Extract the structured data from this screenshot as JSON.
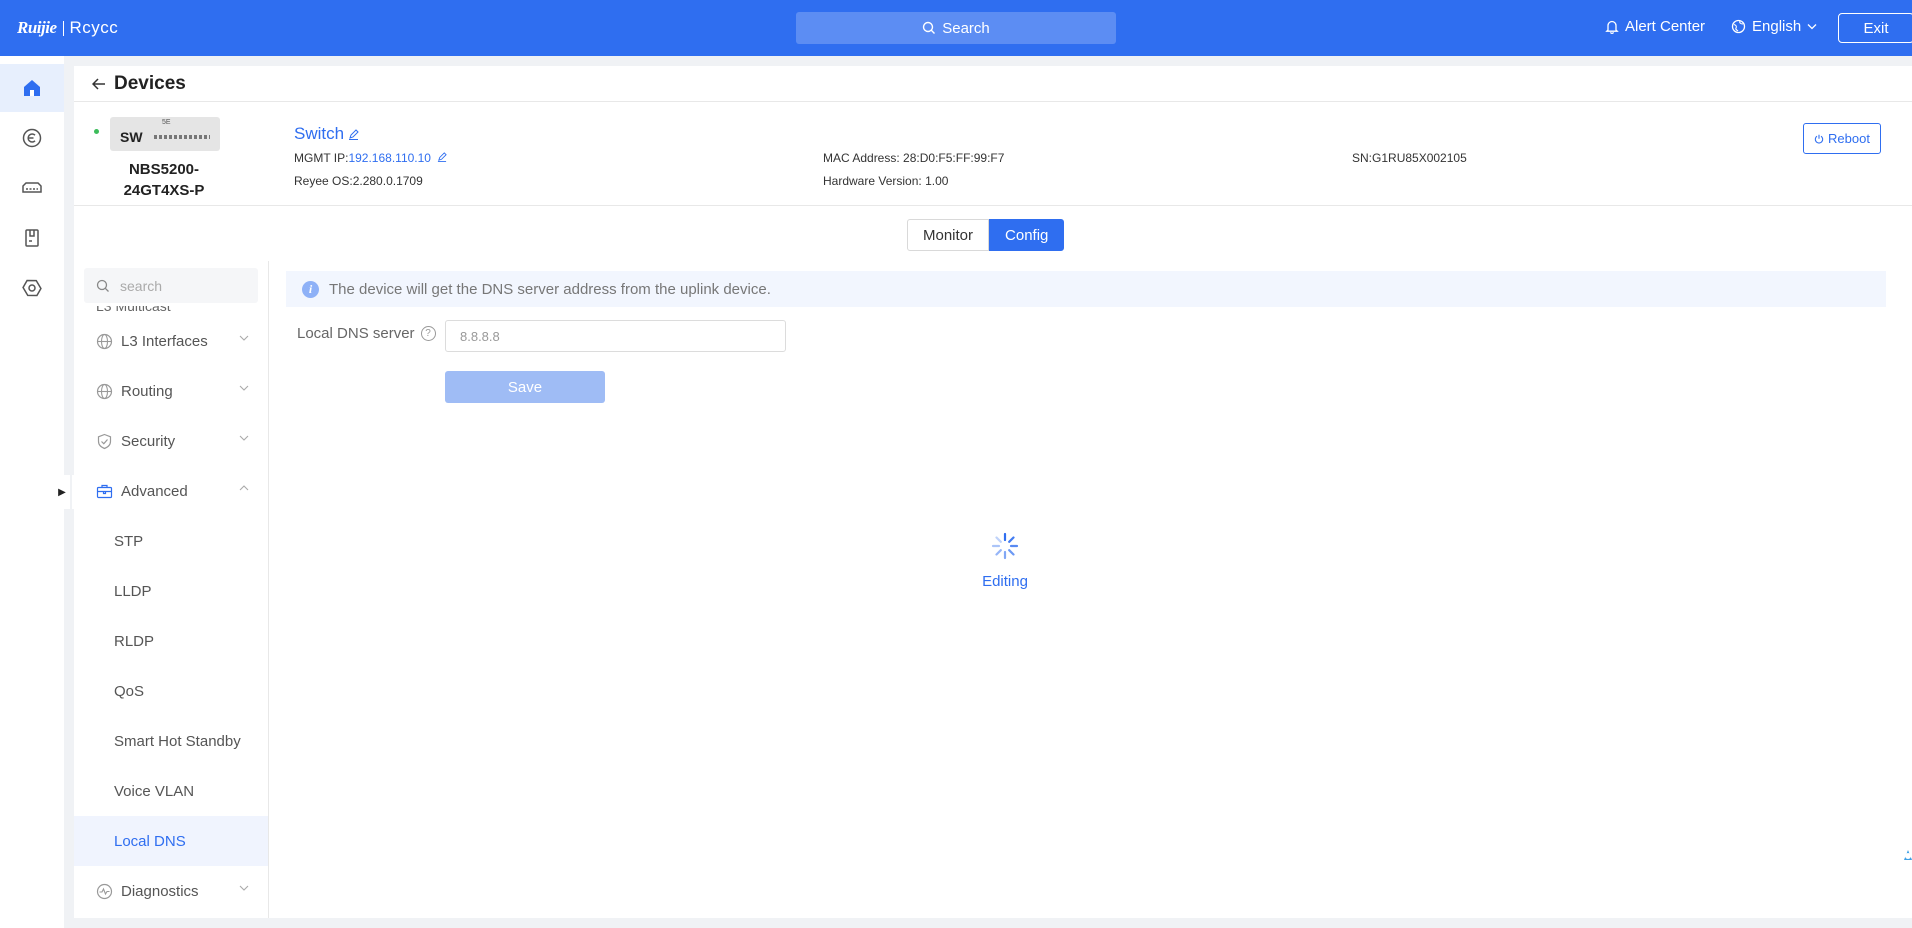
{
  "topbar": {
    "logo_left": "Ruijie",
    "logo_right": "Rcycc",
    "search_label": "Search",
    "alert_center": "Alert Center",
    "language": "English",
    "exit": "Exit"
  },
  "rail": {
    "items": [
      {
        "icon": "home-icon",
        "active": true
      },
      {
        "icon": "cloud-c-icon",
        "active": false
      },
      {
        "icon": "switch-device-icon",
        "active": false
      },
      {
        "icon": "clipboard-icon",
        "active": false
      },
      {
        "icon": "hexagon-settings-icon",
        "active": false
      }
    ]
  },
  "page": {
    "title": "Devices"
  },
  "device": {
    "image_label": "SW",
    "model": "NBS5200-24GT4XS-P",
    "name": "Switch",
    "mgmt_ip_label": "MGMT IP:",
    "mgmt_ip": "192.168.110.10",
    "os_label": "Reyee OS:",
    "os_version": "2.280.0.1709",
    "mac_label": "MAC Address:",
    "mac": "28:D0:F5:FF:99:F7",
    "hw_label": "Hardware Version:",
    "hw_version": "1.00",
    "sn_label": "SN:",
    "sn": "G1RU85X002105",
    "reboot": "Reboot",
    "status_color": "#3cbc5a"
  },
  "tabs": [
    {
      "label": "Monitor",
      "active": false
    },
    {
      "label": "Config",
      "active": true
    }
  ],
  "menu": {
    "search_placeholder": "search",
    "clipped_item": "L3 Multicast",
    "items": [
      {
        "label": "L3 Interfaces",
        "icon": "globe-icon",
        "expandable": true
      },
      {
        "label": "Routing",
        "icon": "globe-icon",
        "expandable": true
      },
      {
        "label": "Security",
        "icon": "shield-icon",
        "expandable": true
      },
      {
        "label": "Advanced",
        "icon": "briefcase-icon",
        "expandable": true,
        "expanded": true
      },
      {
        "label": "STP",
        "sub": true
      },
      {
        "label": "LLDP",
        "sub": true
      },
      {
        "label": "RLDP",
        "sub": true
      },
      {
        "label": "QoS",
        "sub": true
      },
      {
        "label": "Smart Hot Standby",
        "sub": true
      },
      {
        "label": "Voice VLAN",
        "sub": true
      },
      {
        "label": "Local DNS",
        "sub": true,
        "selected": true
      },
      {
        "label": "Diagnostics",
        "icon": "pulse-icon",
        "expandable": true
      }
    ]
  },
  "content": {
    "info_text": "The device will get the DNS server address from the uplink device.",
    "field_label": "Local DNS server",
    "field_value": "8.8.8.8",
    "save": "Save",
    "loading_text": "Editing"
  },
  "colors": {
    "accent": "#2f6ef0",
    "topbar": "#2f6ef0",
    "selected_bg": "#f0f4fe"
  }
}
